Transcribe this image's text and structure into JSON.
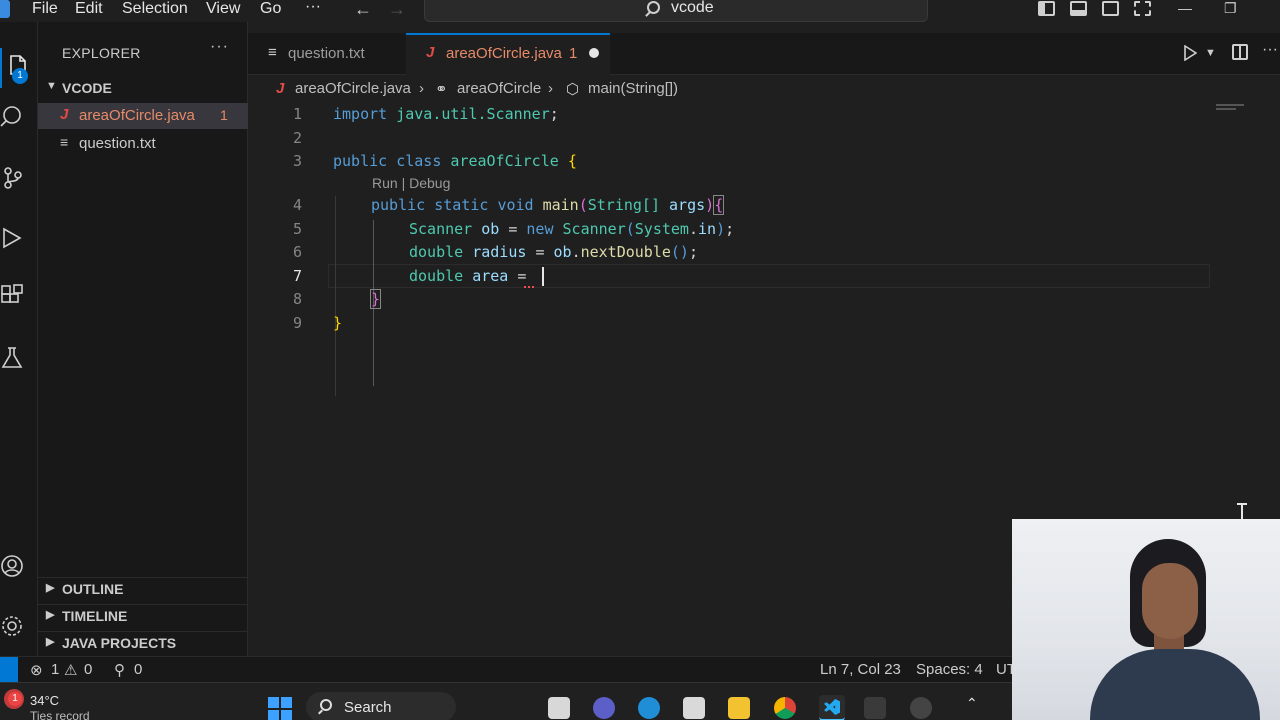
{
  "menu": {
    "file": "File",
    "edit": "Edit",
    "selection": "Selection",
    "view": "View",
    "go": "Go",
    "more": "···"
  },
  "command_center": {
    "text": "vcode"
  },
  "sidebar": {
    "title": "EXPLORER",
    "more": "···",
    "folder": "VCODE",
    "files": [
      {
        "name": "areaOfCircle.java",
        "problems": "1",
        "glyph": "J"
      },
      {
        "name": "question.txt",
        "glyph": "≡"
      }
    ],
    "sections": [
      "OUTLINE",
      "TIMELINE",
      "JAVA PROJECTS"
    ]
  },
  "activity_badge": "1",
  "tabs": [
    {
      "label": "question.txt",
      "glyph": "≡"
    },
    {
      "label": "areaOfCircle.java",
      "problems": "1",
      "glyph": "J"
    }
  ],
  "breadcrumb": {
    "file": "areaOfCircle.java",
    "class": "areaOfCircle",
    "method": "main(String[])",
    "sep": "›"
  },
  "codelens": "Run | Debug",
  "code": {
    "lines": [
      {
        "n": "1"
      },
      {
        "n": "2"
      },
      {
        "n": "3"
      },
      {
        "n": "4"
      },
      {
        "n": "5"
      },
      {
        "n": "6"
      },
      {
        "n": "7"
      },
      {
        "n": "8"
      },
      {
        "n": "9"
      }
    ],
    "tokens": {
      "import": "import",
      "pkg": "java.util.Scanner",
      "semi": ";",
      "public": "public",
      "class": "class",
      "classname": "areaOfCircle",
      "lbrace": "{",
      "static": "static",
      "void": "void",
      "main": "main",
      "lparen": "(",
      "string": "String[]",
      "args": "args",
      "rparen": ")",
      "scanner": "Scanner",
      "ob": "ob",
      "eq": "=",
      "new": "new",
      "system": "System",
      "dot": ".",
      "in": "in",
      "double": "double",
      "radius": "radius",
      "nextdouble": "nextDouble",
      "emptyparens": "()",
      "area": "area",
      "rbrace": "}"
    }
  },
  "statusbar": {
    "errors": "1",
    "warnings": "0",
    "ports": "0",
    "position": "Ln 7, Col 23",
    "spaces": "Spaces: 4",
    "encoding": "UT"
  },
  "taskbar": {
    "temperature": "34°C",
    "weather_text": "Ties record",
    "search": "Search",
    "notification": "1"
  },
  "colors": {
    "accent": "#0078d4",
    "keyword": "#569cd6",
    "type": "#4ec9b0",
    "function": "#dcdcaa",
    "variable": "#9cdcfe",
    "bracket": "#ffd700",
    "java_icon": "#e04c47",
    "problem": "#e78a6a"
  }
}
